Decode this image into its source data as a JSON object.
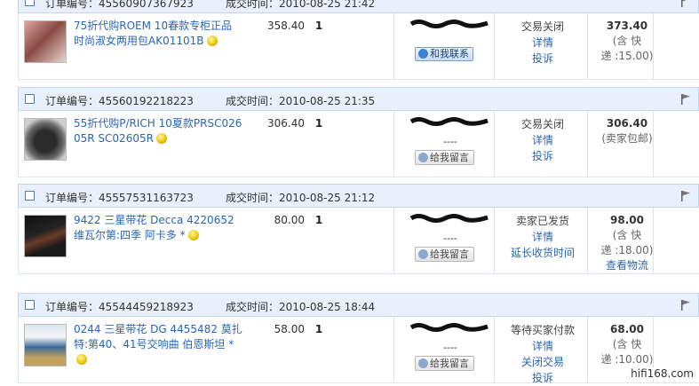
{
  "colors": {
    "header_bg": "#e7f0fb",
    "link": "#2a66b3"
  },
  "labels": {
    "order_no_prefix": "订单编号：",
    "time_prefix": "成交时间：",
    "contact_button": "和我联系",
    "message_button": "给我留言"
  },
  "orders": [
    {
      "order_no": "45560907367923",
      "time": "2010-08-25 21:42",
      "title": "75折代购ROEM 10春款专柜正品时尚淑女两用包AK01101B",
      "price": "358.40",
      "qty": "1",
      "seller_button": "和我联系",
      "status": "交易关闭",
      "links": [
        "详情",
        "投诉"
      ],
      "total": "373.40",
      "total_note_1": "(含 快",
      "total_note_2": "递 :15.00)",
      "total_link": ""
    },
    {
      "order_no": "45560192218223",
      "time": "2010-08-25 21:35",
      "title": "55折代购P/RICH 10夏款PRSC02605R SC02605R",
      "price": "306.40",
      "qty": "1",
      "seller_dash": "----",
      "seller_button": "给我留言",
      "status": "交易关闭",
      "links": [
        "详情",
        "投诉"
      ],
      "total": "306.40",
      "total_note_1": "(卖家包邮)",
      "total_note_2": "",
      "total_link": ""
    },
    {
      "order_no": "45557531163723",
      "time": "2010-08-25 21:12",
      "title": "9422 三星带花 Decca 4220652 维瓦尔第:四季 阿卡多 *",
      "price": "80.00",
      "qty": "1",
      "seller_dash": "----",
      "seller_button": "给我留言",
      "status": "卖家已发货",
      "links": [
        "详情",
        "延长收货时间"
      ],
      "total": "98.00",
      "total_note_1": "(含 快",
      "total_note_2": "递 :18.00)",
      "total_link": "查看物流"
    },
    {
      "order_no": "45544459218923",
      "time": "2010-08-25 18:44",
      "title": "0244 三星带花 DG 4455482 莫扎特:第40、41号交响曲 伯恩斯坦 *",
      "price": "58.00",
      "qty": "1",
      "seller_dash": "----",
      "seller_button": "给我留言",
      "status": "等待买家付款",
      "links": [
        "详情",
        "关闭交易",
        "投诉"
      ],
      "total": "68.00",
      "total_note_1": "(含 快",
      "total_note_2": "递 :10.00)",
      "total_link": ""
    }
  ],
  "watermark": "hifi168.com"
}
